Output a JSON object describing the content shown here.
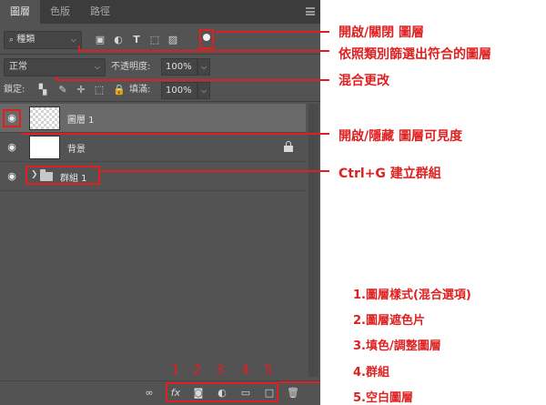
{
  "tabs": [
    "圖層",
    "色版",
    "路徑"
  ],
  "filter": {
    "kind_label": "種類"
  },
  "blend": {
    "mode": "正常",
    "opacity_label": "不透明度:",
    "opacity_value": "100%"
  },
  "lock_row": {
    "lock_label": "鎖定:",
    "fill_label": "填滿:",
    "fill_value": "100%"
  },
  "layers": [
    {
      "name": "圖層 1"
    },
    {
      "name": "背景"
    },
    {
      "name": "群組 1"
    }
  ],
  "bottom_numbers": [
    "1",
    "2",
    "3",
    "4",
    "5"
  ],
  "fx_label": "fx",
  "annotations": {
    "toggle_filter": "開啟/關閉 圖層",
    "filter_by_kind": "依照類別篩選出符合的圖層",
    "blend_change": "混合更改",
    "visibility": "開啟/隱藏 圖層可見度",
    "group": "Ctrl+G 建立群組"
  },
  "legend": [
    "1.圖層樣式(混合選項)",
    "2.圖層遮色片",
    "3.填色/調整圖層",
    "4.群組",
    "5.空白圖層"
  ],
  "colors": {
    "annotation_red": "#e02020",
    "panel_bg": "#535353",
    "selected_row": "#696969"
  }
}
